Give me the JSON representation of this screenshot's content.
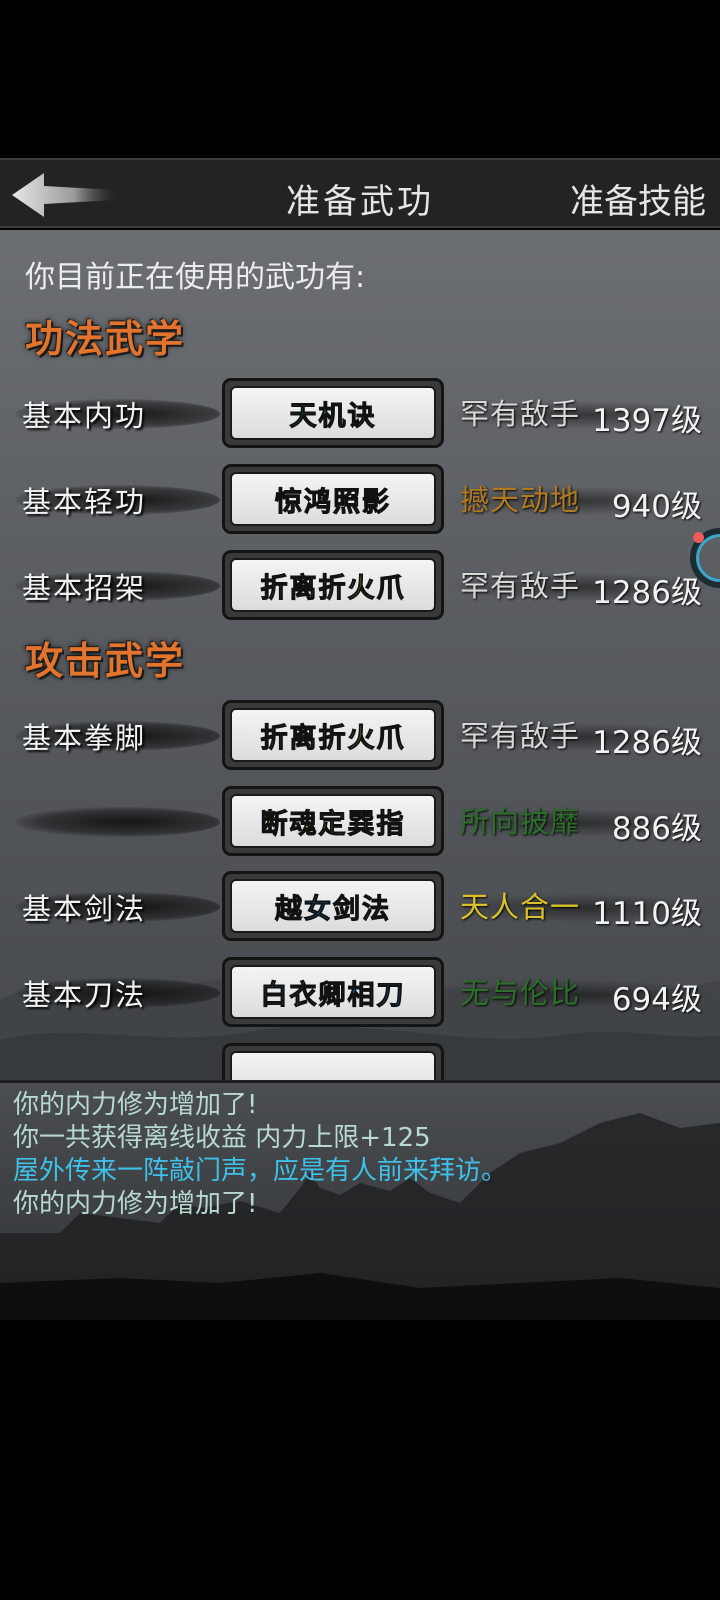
{
  "header": {
    "title": "准备武功",
    "right_tab": "准备技能"
  },
  "panel": {
    "intro": "你目前正在使用的武功有:",
    "sections": [
      {
        "heading": "功法武学",
        "rows": [
          {
            "label": "基本内功",
            "skill": "天机诀",
            "skill_color": "#1f9e3a",
            "rank": "罕有敌手",
            "rank_color": "#d8d8d8",
            "level": "1397级"
          },
          {
            "label": "基本轻功",
            "skill": "惊鸿照影",
            "skill_color": "#1f9e3a",
            "rank": "撼天动地",
            "rank_color": "#b07a22",
            "level": "940级"
          },
          {
            "label": "基本招架",
            "skill": "折离折火爪",
            "skill_color": "#d8c12a",
            "rank": "罕有敌手",
            "rank_color": "#d8d8d8",
            "level": "1286级"
          }
        ]
      },
      {
        "heading": "攻击武学",
        "rows": [
          {
            "label": "基本拳脚",
            "skill": "折离折火爪",
            "skill_color": "#d8c12a",
            "rank": "罕有敌手",
            "rank_color": "#d8d8d8",
            "level": "1286级"
          },
          {
            "label": "",
            "skill": "断魂定巽指",
            "skill_color": "#d8c12a",
            "rank": "所向披靡",
            "rank_color": "#2c6e2a",
            "level": "886级"
          },
          {
            "label": "基本剑法",
            "skill": "越女剑法",
            "skill_color": "#1a7fc8",
            "rank": "天人合一",
            "rank_color": "#d8c12a",
            "level": "1110级"
          },
          {
            "label": "基本刀法",
            "skill": "白衣卿相刀",
            "skill_color": "#1a7fc8",
            "rank": "无与伦比",
            "rank_color": "#2c6e2a",
            "level": "694级"
          }
        ]
      }
    ]
  },
  "log": {
    "lines": [
      {
        "text": "你的内力修为增加了!",
        "color": "#b8d8d0"
      },
      {
        "text": "你一共获得离线收益 内力上限+125",
        "color": "#b8d8d0"
      },
      {
        "text": "屋外传来一阵敲门声，应是有人前来拜访。",
        "color": "#3fc0e8"
      },
      {
        "text": "你的内力修为增加了!",
        "color": "#b8d8d0"
      }
    ]
  },
  "icons": {
    "back": "back-arrow-icon",
    "side_widget": "floating-ball-icon"
  }
}
